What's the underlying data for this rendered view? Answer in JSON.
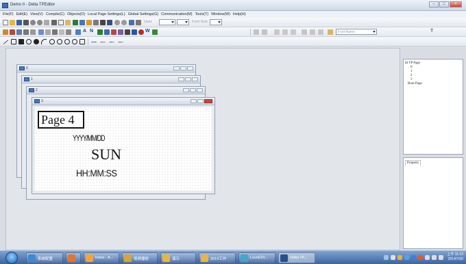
{
  "window": {
    "title": "Demo II - Delta TPEditor"
  },
  "menu": [
    "File(F)",
    "Edit(E)",
    "View(V)",
    "Compile(C)",
    "Objects(O)",
    "Local Page Settings(L)",
    "Global Settings(G)",
    "Communication(M)",
    "Tools(T)",
    "Window(W)",
    "Help(H)"
  ],
  "toolbar": {
    "user_label": "User",
    "font_label": "Font Size",
    "font_name": "Font Name",
    "text_tool": "T"
  },
  "page_windows": [
    {
      "title": "0"
    },
    {
      "title": "1"
    },
    {
      "title": "2"
    },
    {
      "title": "3"
    }
  ],
  "front_window": {
    "page_label": "Page 4",
    "date_format": "YYYY/MM/DD",
    "day_label": "SUN",
    "time_format": "HH:MM:SS"
  },
  "project_tree": {
    "root": "TP Page",
    "pages": [
      "0",
      "1",
      "2",
      "3"
    ],
    "boot": "Boot Page"
  },
  "properties": {
    "tab": "Property"
  },
  "taskbar": {
    "items": [
      "系统配置",
      "",
      "Inbox - A...",
      "视频播放",
      "演示",
      "2014工作",
      "LoveEDI...",
      "Delta TP..."
    ],
    "clock_time": "上午 11:12",
    "clock_date": "2014/7/30"
  }
}
